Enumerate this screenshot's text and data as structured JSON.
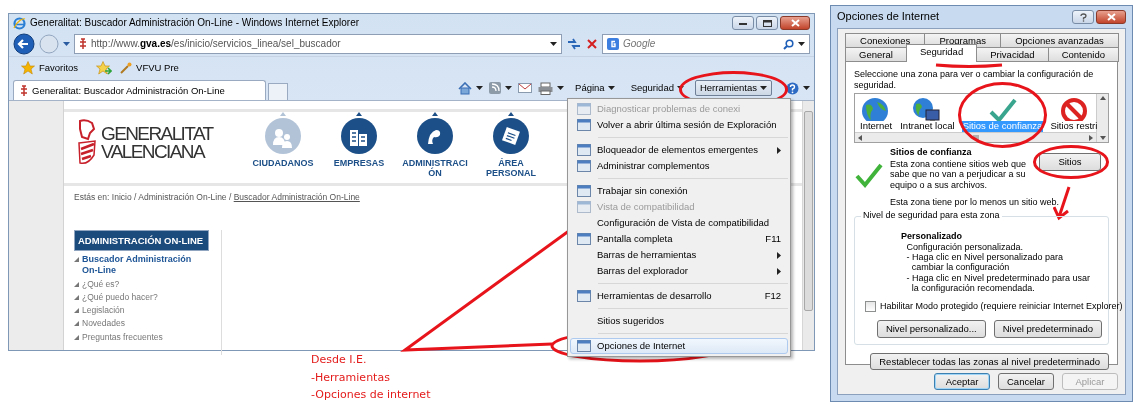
{
  "browser": {
    "title": "Generalitat: Buscador Administración On-Line - Windows Internet Explorer",
    "address": "http://www.**gva.es**/es/inicio/servicios_linea/sel_buscador",
    "search": {
      "placeholder": "Google"
    },
    "favorites": {
      "label": "Favoritos",
      "links": [
        "VFVU Pre"
      ]
    },
    "tabs": [
      {
        "label": "Generalitat: Buscador Administración On-Line",
        "selected": true
      }
    ],
    "command_bar": [
      {
        "label": "Página",
        "selected": false
      },
      {
        "label": "Seguridad",
        "selected": false
      },
      {
        "label": "Herramientas",
        "selected": true
      }
    ]
  },
  "site": {
    "logo": [
      "GENERALITAT",
      "VALENCIANA"
    ],
    "nav": [
      {
        "label": "CIUDADANOS",
        "selected": true
      },
      {
        "label": "EMPRESAS",
        "selected": false
      },
      {
        "label": "ADMINISTRACIÓN",
        "selected": false
      },
      {
        "label": "ÁREA PERSONAL",
        "selected": false
      }
    ],
    "breadcrumb": {
      "path": "Estás en: Inicio / Administración On-Line /",
      "current": "Buscador Administración On-Line"
    },
    "sidebar": {
      "title": "ADMINISTRACIÓN ON-LINE",
      "items": [
        {
          "label": "Buscador Administración On-Line",
          "selected": true
        },
        {
          "label": "¿Qué es?",
          "selected": false
        },
        {
          "label": "¿Qué puedo hacer?",
          "selected": false
        },
        {
          "label": "Legislación",
          "selected": false
        },
        {
          "label": "Novedades",
          "selected": false
        },
        {
          "label": "Preguntas frecuentes",
          "selected": false
        }
      ]
    }
  },
  "menu": {
    "groups": [
      [
        {
          "label": "Diagnosticar problemas de conexi",
          "icon": true,
          "disabled": true,
          "submenu": false,
          "selected": false
        },
        {
          "label": "Volver a abrir última sesión de Exploración",
          "icon": true,
          "disabled": false,
          "submenu": false,
          "selected": false
        }
      ],
      [
        {
          "label": "Bloqueador de elementos emergentes",
          "icon": true,
          "disabled": false,
          "submenu": true,
          "selected": false
        },
        {
          "label": "Administrar complementos",
          "icon": true,
          "disabled": false,
          "submenu": false,
          "selected": false
        }
      ],
      [
        {
          "label": "Trabajar sin conexión",
          "icon": true,
          "disabled": false,
          "submenu": false,
          "selected": false
        },
        {
          "label": "Vista de compatibilidad",
          "icon": true,
          "disabled": true,
          "submenu": false,
          "selected": false
        },
        {
          "label": "Configuración de Vista de compatibilidad",
          "icon": false,
          "disabled": false,
          "submenu": false,
          "selected": false
        },
        {
          "label": "Pantalla completa",
          "icon": true,
          "disabled": false,
          "submenu": false,
          "selected": false,
          "shortcut": "F11"
        },
        {
          "label": "Barras de herramientas",
          "icon": false,
          "disabled": false,
          "submenu": true,
          "selected": false
        },
        {
          "label": "Barras del explorador",
          "icon": false,
          "disabled": false,
          "submenu": true,
          "selected": false
        }
      ],
      [
        {
          "label": "Herramientas de desarrollo",
          "icon": true,
          "disabled": false,
          "submenu": false,
          "selected": false,
          "shortcut": "F12"
        }
      ],
      [
        {
          "label": "Sitios sugeridos",
          "icon": false,
          "disabled": false,
          "submenu": false,
          "selected": false
        }
      ],
      [
        {
          "label": "Opciones de Internet",
          "icon": true,
          "disabled": false,
          "submenu": false,
          "selected": true
        }
      ]
    ]
  },
  "note": [
    "Desde I.E.",
    "-Herramientas",
    "-Opciones de internet"
  ],
  "dialog": {
    "title": "Opciones de Internet",
    "tab_rows": [
      [
        {
          "label": "Conexiones",
          "selected": false
        },
        {
          "label": "Programas",
          "selected": false
        },
        {
          "label": "Opciones avanzadas",
          "selected": false
        }
      ],
      [
        {
          "label": "General",
          "selected": false
        },
        {
          "label": "Seguridad",
          "selected": true
        },
        {
          "label": "Privacidad",
          "selected": false
        },
        {
          "label": "Contenido",
          "selected": false
        }
      ]
    ],
    "prompt": "Seleccione una zona para ver o cambiar la configuración de seguridad.",
    "zones": [
      {
        "label": "Internet",
        "selected": false
      },
      {
        "label": "Intranet local",
        "selected": false
      },
      {
        "label": "Sitios de confianza",
        "selected": true
      },
      {
        "label": "Sitios restri",
        "selected": false
      }
    ],
    "zone_title": "Sitios de confianza",
    "zone_description": "Esta zona contiene sitios web que sabe que no van a perjudicar a su equipo o a sus archivos.",
    "sites_button": "Sitios",
    "zone_note": "Esta zona tiene por lo menos un sitio web.",
    "level_group": "Nivel de seguridad para esta zona",
    "level_title": "Personalizado",
    "level_lines": [
      "Configuración personalizada.",
      "- Haga clic en Nivel personalizado para cambiar la configuración",
      "- Haga clic en Nivel predeterminado para usar la configuración recomendada."
    ],
    "protected_mode": {
      "label": "Habilitar Modo protegido (requiere reiniciar Internet Explorer)",
      "checked": false
    },
    "level_buttons": [
      "Nivel personalizado...",
      "Nivel predeterminado"
    ],
    "reset_button": "Restablecer todas las zonas al nivel predeterminado",
    "footer_buttons": [
      {
        "label": "Aceptar",
        "default": true,
        "disabled": false
      },
      {
        "label": "Cancelar",
        "default": false,
        "disabled": false
      },
      {
        "label": "Aplicar",
        "default": false,
        "disabled": true
      }
    ]
  }
}
